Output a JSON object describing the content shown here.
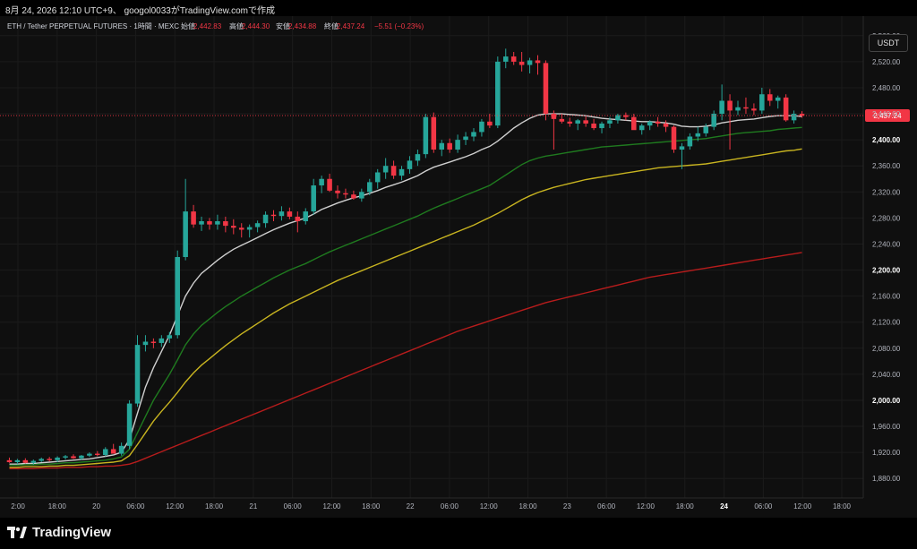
{
  "header": {
    "title": "8月 24, 2026 12:10 UTC+9、 googol0033がTradingView.comで作成"
  },
  "legend": {
    "symbol": "ETH / Tether PERPETUAL FUTURES · 1時間 · MEXC",
    "open_label": "始値",
    "open": "2,442.83",
    "high_label": "高値",
    "high": "2,444.30",
    "low_label": "安値",
    "low": "2,434.88",
    "close_label": "終値",
    "close": "2,437.24",
    "change": "−5.51 (−0.23%)"
  },
  "currency_button": "USDT",
  "brand": "TradingView",
  "colors": {
    "up": "#26a69a",
    "down": "#f23645",
    "ma_white": "#cfcfcf",
    "ma_green": "#1f7a1f",
    "ma_yellow": "#c8b420",
    "ma_red": "#b71c1c",
    "price_line": "#f23645"
  },
  "chart_data": {
    "type": "candlestick",
    "y_axis": {
      "range": [
        1850,
        2590
      ],
      "ticks": [
        "2,560.00",
        "2,520.00",
        "2,480.00",
        "2,440.00",
        "2,400.00",
        "2,360.00",
        "2,320.00",
        "2,280.00",
        "2,240.00",
        "2,200.00",
        "2,160.00",
        "2,120.00",
        "2,080.00",
        "2,040.00",
        "2,000.00",
        "1,960.00",
        "1,920.00",
        "1,880.00"
      ],
      "bold_ticks": [
        "2,400.00",
        "2,200.00",
        "2,000.00"
      ],
      "current_price_label": "2,437.24",
      "current_price": 2437.24
    },
    "x_axis": {
      "ticks": [
        "2:00",
        "18:00",
        "20",
        "06:00",
        "12:00",
        "18:00",
        "21",
        "06:00",
        "12:00",
        "18:00",
        "22",
        "06:00",
        "12:00",
        "18:00",
        "23",
        "06:00",
        "12:00",
        "18:00",
        "24",
        "06:00",
        "12:00",
        "18:00"
      ],
      "bold_ticks": [
        "24"
      ]
    },
    "candles": [
      [
        1908,
        1912,
        1904,
        1905
      ],
      [
        1905,
        1910,
        1902,
        1908
      ],
      [
        1908,
        1911,
        1903,
        1904
      ],
      [
        1904,
        1909,
        1901,
        1907
      ],
      [
        1907,
        1912,
        1905,
        1910
      ],
      [
        1910,
        1913,
        1906,
        1908
      ],
      [
        1908,
        1914,
        1905,
        1912
      ],
      [
        1912,
        1916,
        1909,
        1914
      ],
      [
        1914,
        1917,
        1910,
        1911
      ],
      [
        1911,
        1916,
        1908,
        1915
      ],
      [
        1915,
        1920,
        1913,
        1918
      ],
      [
        1918,
        1922,
        1914,
        1916
      ],
      [
        1916,
        1928,
        1914,
        1925
      ],
      [
        1925,
        1933,
        1920,
        1918
      ],
      [
        1918,
        1935,
        1915,
        1930
      ],
      [
        1930,
        2000,
        1925,
        1995
      ],
      [
        1995,
        2100,
        1990,
        2085
      ],
      [
        2085,
        2100,
        2075,
        2090
      ],
      [
        2090,
        2095,
        2080,
        2088
      ],
      [
        2088,
        2100,
        2082,
        2095
      ],
      [
        2095,
        2105,
        2088,
        2100
      ],
      [
        2100,
        2230,
        2095,
        2220
      ],
      [
        2220,
        2340,
        2215,
        2290
      ],
      [
        2290,
        2300,
        2265,
        2270
      ],
      [
        2270,
        2282,
        2260,
        2275
      ],
      [
        2275,
        2280,
        2262,
        2270
      ],
      [
        2270,
        2285,
        2262,
        2275
      ],
      [
        2275,
        2282,
        2258,
        2268
      ],
      [
        2268,
        2278,
        2255,
        2265
      ],
      [
        2265,
        2272,
        2250,
        2262
      ],
      [
        2262,
        2270,
        2250,
        2266
      ],
      [
        2266,
        2276,
        2258,
        2272
      ],
      [
        2272,
        2290,
        2265,
        2285
      ],
      [
        2285,
        2292,
        2275,
        2283
      ],
      [
        2283,
        2298,
        2276,
        2290
      ],
      [
        2290,
        2296,
        2278,
        2282
      ],
      [
        2282,
        2290,
        2258,
        2275
      ],
      [
        2275,
        2295,
        2270,
        2290
      ],
      [
        2290,
        2340,
        2285,
        2330
      ],
      [
        2330,
        2345,
        2318,
        2340
      ],
      [
        2340,
        2348,
        2320,
        2322
      ],
      [
        2322,
        2330,
        2310,
        2318
      ],
      [
        2318,
        2325,
        2310,
        2316
      ],
      [
        2316,
        2322,
        2308,
        2310
      ],
      [
        2310,
        2325,
        2305,
        2320
      ],
      [
        2320,
        2340,
        2315,
        2335
      ],
      [
        2335,
        2355,
        2325,
        2350
      ],
      [
        2350,
        2372,
        2340,
        2360
      ],
      [
        2360,
        2368,
        2340,
        2345
      ],
      [
        2345,
        2360,
        2338,
        2355
      ],
      [
        2355,
        2375,
        2348,
        2368
      ],
      [
        2368,
        2385,
        2360,
        2378
      ],
      [
        2378,
        2440,
        2372,
        2435
      ],
      [
        2435,
        2442,
        2380,
        2385
      ],
      [
        2385,
        2400,
        2375,
        2395
      ],
      [
        2395,
        2402,
        2380,
        2385
      ],
      [
        2385,
        2408,
        2380,
        2400
      ],
      [
        2400,
        2412,
        2392,
        2405
      ],
      [
        2405,
        2418,
        2398,
        2412
      ],
      [
        2412,
        2432,
        2405,
        2428
      ],
      [
        2428,
        2440,
        2418,
        2422
      ],
      [
        2422,
        2528,
        2418,
        2520
      ],
      [
        2520,
        2540,
        2510,
        2528
      ],
      [
        2528,
        2535,
        2515,
        2520
      ],
      [
        2520,
        2535,
        2505,
        2515
      ],
      [
        2515,
        2526,
        2502,
        2522
      ],
      [
        2522,
        2530,
        2500,
        2518
      ],
      [
        2518,
        2522,
        2430,
        2440
      ],
      [
        2440,
        2445,
        2385,
        2432
      ],
      [
        2432,
        2440,
        2425,
        2428
      ],
      [
        2428,
        2434,
        2420,
        2425
      ],
      [
        2425,
        2432,
        2415,
        2430
      ],
      [
        2430,
        2436,
        2420,
        2425
      ],
      [
        2425,
        2432,
        2415,
        2418
      ],
      [
        2418,
        2428,
        2410,
        2425
      ],
      [
        2425,
        2435,
        2418,
        2430
      ],
      [
        2430,
        2440,
        2425,
        2438
      ],
      [
        2438,
        2442,
        2430,
        2435
      ],
      [
        2435,
        2440,
        2420,
        2415
      ],
      [
        2415,
        2425,
        2408,
        2422
      ],
      [
        2422,
        2430,
        2415,
        2428
      ],
      [
        2428,
        2435,
        2420,
        2425
      ],
      [
        2425,
        2430,
        2412,
        2420
      ],
      [
        2420,
        2422,
        2380,
        2385
      ],
      [
        2385,
        2395,
        2355,
        2390
      ],
      [
        2390,
        2410,
        2385,
        2405
      ],
      [
        2405,
        2420,
        2398,
        2410
      ],
      [
        2410,
        2425,
        2405,
        2420
      ],
      [
        2420,
        2445,
        2415,
        2440
      ],
      [
        2440,
        2485,
        2430,
        2460
      ],
      [
        2460,
        2470,
        2385,
        2445
      ],
      [
        2445,
        2460,
        2438,
        2450
      ],
      [
        2450,
        2465,
        2440,
        2448
      ],
      [
        2448,
        2456,
        2438,
        2445
      ],
      [
        2445,
        2480,
        2440,
        2470
      ],
      [
        2470,
        2478,
        2452,
        2460
      ],
      [
        2460,
        2468,
        2448,
        2465
      ],
      [
        2465,
        2470,
        2428,
        2430
      ],
      [
        2430,
        2445,
        2425,
        2440
      ],
      [
        2440,
        2444,
        2434,
        2437
      ]
    ],
    "moving_averages": [
      {
        "color": "#cfcfcf",
        "values": [
          1902,
          1902,
          1903,
          1903,
          1904,
          1905,
          1906,
          1907,
          1908,
          1909,
          1910,
          1912,
          1914,
          1916,
          1920,
          1940,
          1980,
          2020,
          2050,
          2075,
          2100,
          2130,
          2160,
          2180,
          2195,
          2205,
          2215,
          2224,
          2232,
          2238,
          2244,
          2250,
          2256,
          2262,
          2267,
          2272,
          2276,
          2280,
          2286,
          2293,
          2298,
          2303,
          2307,
          2311,
          2314,
          2318,
          2322,
          2327,
          2331,
          2335,
          2340,
          2345,
          2352,
          2358,
          2362,
          2366,
          2370,
          2374,
          2379,
          2385,
          2390,
          2398,
          2408,
          2418,
          2426,
          2433,
          2438,
          2440,
          2440,
          2440,
          2439,
          2438,
          2437,
          2435,
          2433,
          2432,
          2431,
          2430,
          2429,
          2428,
          2428,
          2427,
          2426,
          2424,
          2421,
          2420,
          2420,
          2421,
          2423,
          2426,
          2428,
          2430,
          2431,
          2432,
          2434,
          2436,
          2437,
          2437,
          2437,
          2436
        ]
      },
      {
        "color": "#1f7a1f",
        "values": [
          1900,
          1900,
          1901,
          1901,
          1902,
          1902,
          1903,
          1904,
          1904,
          1905,
          1906,
          1907,
          1908,
          1910,
          1913,
          1925,
          1950,
          1975,
          2000,
          2020,
          2040,
          2062,
          2085,
          2102,
          2115,
          2125,
          2135,
          2144,
          2152,
          2160,
          2167,
          2174,
          2181,
          2188,
          2194,
          2200,
          2205,
          2210,
          2216,
          2222,
          2228,
          2233,
          2238,
          2243,
          2248,
          2253,
          2258,
          2263,
          2268,
          2273,
          2278,
          2283,
          2289,
          2295,
          2300,
          2305,
          2310,
          2315,
          2320,
          2325,
          2330,
          2338,
          2346,
          2354,
          2362,
          2368,
          2372,
          2375,
          2377,
          2379,
          2381,
          2383,
          2385,
          2387,
          2389,
          2390,
          2391,
          2392,
          2393,
          2394,
          2395,
          2396,
          2397,
          2398,
          2399,
          2400,
          2401,
          2402,
          2404,
          2406,
          2408,
          2410,
          2411,
          2412,
          2413,
          2414,
          2416,
          2417,
          2418,
          2419
        ]
      },
      {
        "color": "#c8b420",
        "values": [
          1897,
          1897,
          1898,
          1898,
          1898,
          1899,
          1899,
          1900,
          1900,
          1901,
          1902,
          1903,
          1904,
          1905,
          1907,
          1915,
          1932,
          1950,
          1968,
          1983,
          1997,
          2012,
          2028,
          2042,
          2054,
          2064,
          2074,
          2084,
          2093,
          2102,
          2110,
          2118,
          2126,
          2134,
          2141,
          2148,
          2154,
          2160,
          2166,
          2172,
          2178,
          2184,
          2189,
          2194,
          2199,
          2204,
          2209,
          2214,
          2219,
          2224,
          2229,
          2234,
          2239,
          2244,
          2249,
          2254,
          2259,
          2264,
          2269,
          2275,
          2281,
          2287,
          2294,
          2301,
          2308,
          2314,
          2319,
          2323,
          2327,
          2330,
          2333,
          2336,
          2339,
          2341,
          2343,
          2345,
          2347,
          2349,
          2351,
          2353,
          2355,
          2357,
          2358,
          2359,
          2360,
          2361,
          2362,
          2363,
          2365,
          2367,
          2369,
          2371,
          2373,
          2375,
          2377,
          2379,
          2381,
          2383,
          2384,
          2386
        ]
      },
      {
        "color": "#b71c1c",
        "values": [
          1895,
          1895,
          1895,
          1895,
          1896,
          1896,
          1896,
          1897,
          1897,
          1897,
          1898,
          1898,
          1899,
          1899,
          1900,
          1902,
          1906,
          1911,
          1916,
          1921,
          1926,
          1931,
          1936,
          1941,
          1946,
          1951,
          1956,
          1961,
          1966,
          1971,
          1976,
          1981,
          1986,
          1991,
          1996,
          2001,
          2006,
          2011,
          2016,
          2021,
          2026,
          2031,
          2036,
          2041,
          2046,
          2051,
          2056,
          2061,
          2066,
          2071,
          2076,
          2081,
          2086,
          2091,
          2096,
          2101,
          2106,
          2110,
          2114,
          2118,
          2122,
          2126,
          2130,
          2134,
          2138,
          2142,
          2146,
          2150,
          2153,
          2156,
          2159,
          2162,
          2165,
          2168,
          2171,
          2174,
          2177,
          2180,
          2183,
          2186,
          2189,
          2191,
          2193,
          2195,
          2197,
          2199,
          2201,
          2203,
          2205,
          2207,
          2209,
          2211,
          2213,
          2215,
          2217,
          2219,
          2221,
          2223,
          2225,
          2227
        ]
      }
    ]
  }
}
